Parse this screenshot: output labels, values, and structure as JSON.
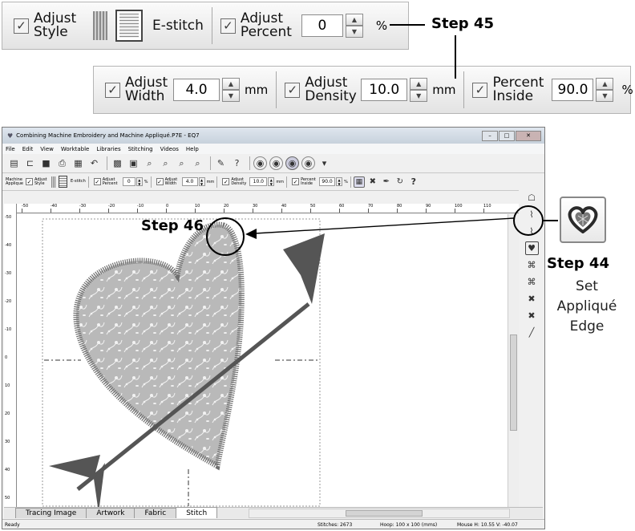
{
  "zoom_top": {
    "adjust_style": "Adjust\nStyle",
    "estitch": "E-stitch",
    "adjust_percent": "Adjust\nPercent",
    "percent_value": "0",
    "percent_unit": "%"
  },
  "zoom_bottom": {
    "adjust_width": "Adjust\nWidth",
    "width_value": "4.0",
    "width_unit": "mm",
    "adjust_density": "Adjust\nDensity",
    "density_value": "10.0",
    "density_unit": "mm",
    "percent_inside": "Percent\nInside",
    "inside_value": "90.0",
    "inside_unit": "%"
  },
  "callouts": {
    "step45": "Step 45",
    "step46": "Step 46",
    "step44": "Step 44",
    "step44_note": "Set\nAppliqué\nEdge"
  },
  "window": {
    "title": "Combining Machine Embroidery and Machine Appliqué.P7E - EQ7",
    "menu": [
      "File",
      "Edit",
      "View",
      "Worktable",
      "Libraries",
      "Stitching",
      "Videos",
      "Help"
    ],
    "toolbar2": {
      "machine_applique": "Machine\nApplique",
      "adjust_style": "Adjust\nStyle",
      "estitch": "E-stitch",
      "adjust_percent": "Adjust\nPercent",
      "percent_value": "0",
      "adjust_width": "Adjust\nWidth",
      "width_value": "4.0",
      "adjust_density": "Adjust\nDensity",
      "density_value": "10.0",
      "percent_inside": "Percent\nInside",
      "inside_value": "90.0",
      "mm": "mm",
      "pct": "%"
    },
    "ruler_top": [
      "-50",
      "-40",
      "-30",
      "-20",
      "-10",
      "0",
      "10",
      "20",
      "30",
      "40",
      "50",
      "60",
      "70",
      "80",
      "90",
      "100",
      "110"
    ],
    "ruler_left": [
      "-50",
      "-40",
      "-30",
      "-20",
      "-10",
      "0",
      "10",
      "20",
      "30",
      "40",
      "50"
    ],
    "tabs": [
      "Tracing Image",
      "Artwork",
      "Fabric",
      "Stitch"
    ],
    "status": {
      "ready": "Ready",
      "stitches": "Stitches: 2673",
      "hoop": "Hoop: 100 x 100 (mms)",
      "mouse": "Mouse  H: 10.55  V: -40.07"
    }
  },
  "icons": {
    "set_applique_edge": "heart-icon",
    "colors": {
      "heart_fill": "#b8b8b8",
      "heart_border": "#777777",
      "arrow": "#555555",
      "callout_heart": "#2a2a2a"
    }
  }
}
